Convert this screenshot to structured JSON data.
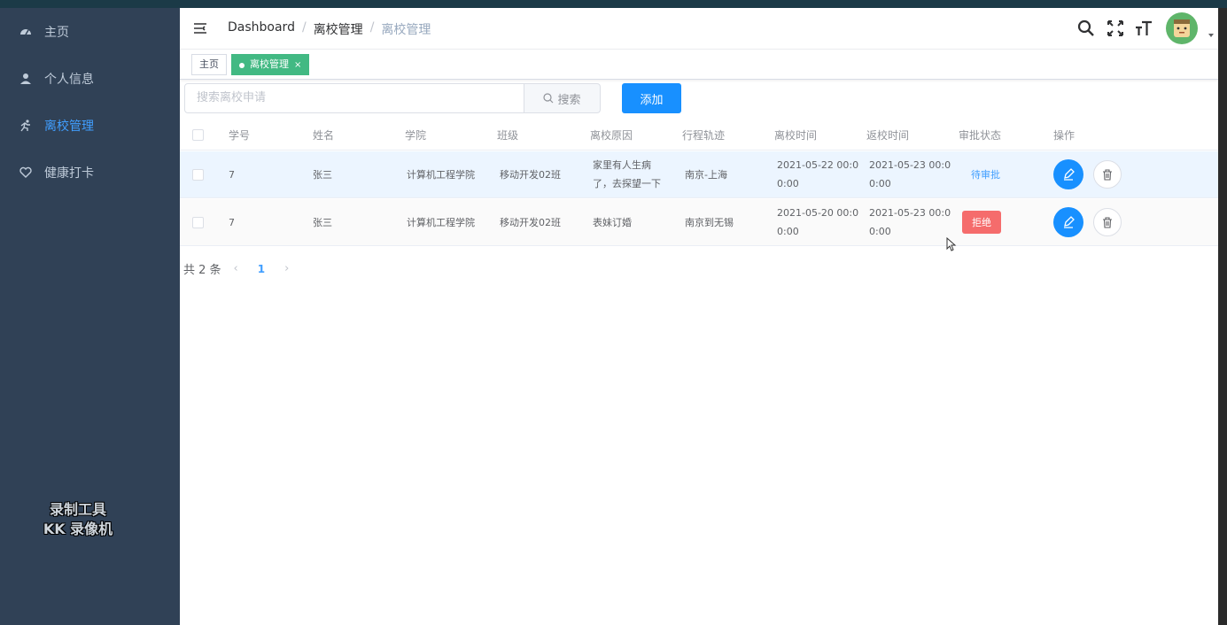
{
  "sidebar": {
    "items": [
      {
        "label": "主页",
        "icon": "dashboard-icon"
      },
      {
        "label": "个人信息",
        "icon": "user-icon"
      },
      {
        "label": "离校管理",
        "icon": "running-icon"
      },
      {
        "label": "健康打卡",
        "icon": "heart-icon"
      }
    ],
    "active_index": 2
  },
  "watermark": {
    "line1": "录制工具",
    "line2": "KK 录像机"
  },
  "navbar": {
    "breadcrumb": [
      "Dashboard",
      "离校管理",
      "离校管理"
    ],
    "icons": [
      "search-icon",
      "fullscreen-icon",
      "font-size-icon"
    ]
  },
  "tags": [
    {
      "label": "主页"
    },
    {
      "label": "离校管理",
      "close": "×"
    }
  ],
  "toolbar": {
    "search_placeholder": "搜索离校申请",
    "search_button": "搜索",
    "add_button": "添加"
  },
  "table": {
    "columns": [
      "学号",
      "姓名",
      "学院",
      "班级",
      "离校原因",
      "行程轨迹",
      "离校时间",
      "返校时间",
      "审批状态",
      "操作"
    ],
    "rows": [
      {
        "id": "7",
        "name": "张三",
        "college": "计算机工程学院",
        "class": "移动开发02班",
        "reason_line1": "家里有人生病",
        "reason_line2": "了，去探望一下",
        "route": "南京-上海",
        "leave_line1": "2021-05-22 00:0",
        "leave_line2": "0:00",
        "return_line1": "2021-05-23 00:0",
        "return_line2": "0:00",
        "status": "待审批"
      },
      {
        "id": "7",
        "name": "张三",
        "college": "计算机工程学院",
        "class": "移动开发02班",
        "reason_line1": "表妹订婚",
        "reason_line2": "",
        "route": "南京到无锡",
        "leave_line1": "2021-05-20 00:0",
        "leave_line2": "0:00",
        "return_line1": "2021-05-23 00:0",
        "return_line2": "0:00",
        "status": "拒绝"
      }
    ]
  },
  "pagination": {
    "total": "共 2 条",
    "prev": "‹",
    "page": "1",
    "next": "›"
  },
  "colors": {
    "sidebar_bg": "#304156",
    "accent": "#409eff",
    "primary_btn": "#1890ff",
    "tag_active": "#42b983",
    "danger": "#f56c6c"
  }
}
